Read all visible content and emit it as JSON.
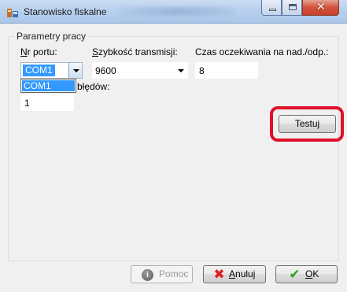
{
  "window": {
    "title": "Stanowisko fiskalne",
    "icon": "app-icon"
  },
  "group": {
    "title": "Parametry pracy"
  },
  "fields": {
    "port_label_underlined": "N",
    "port_label_rest": "r portu:",
    "port_value": "COM1",
    "speed_label_underlined": "S",
    "speed_label_rest": "zybkość transmisji:",
    "speed_value": "9600",
    "timeout_label": "Czas oczekiwania na nad./odp.:",
    "timeout_value": "8",
    "errors_label_visible": "błędów:",
    "errors_value": "1"
  },
  "dropdown": {
    "options": [
      "COM1"
    ]
  },
  "buttons": {
    "test": "Testuj",
    "help": "Pomoc",
    "cancel_underlined": "A",
    "cancel_rest": "nuluj",
    "ok_underlined": "O",
    "ok_rest": "K"
  },
  "colors": {
    "highlight": "#e0102a",
    "selection": "#3399ff"
  }
}
